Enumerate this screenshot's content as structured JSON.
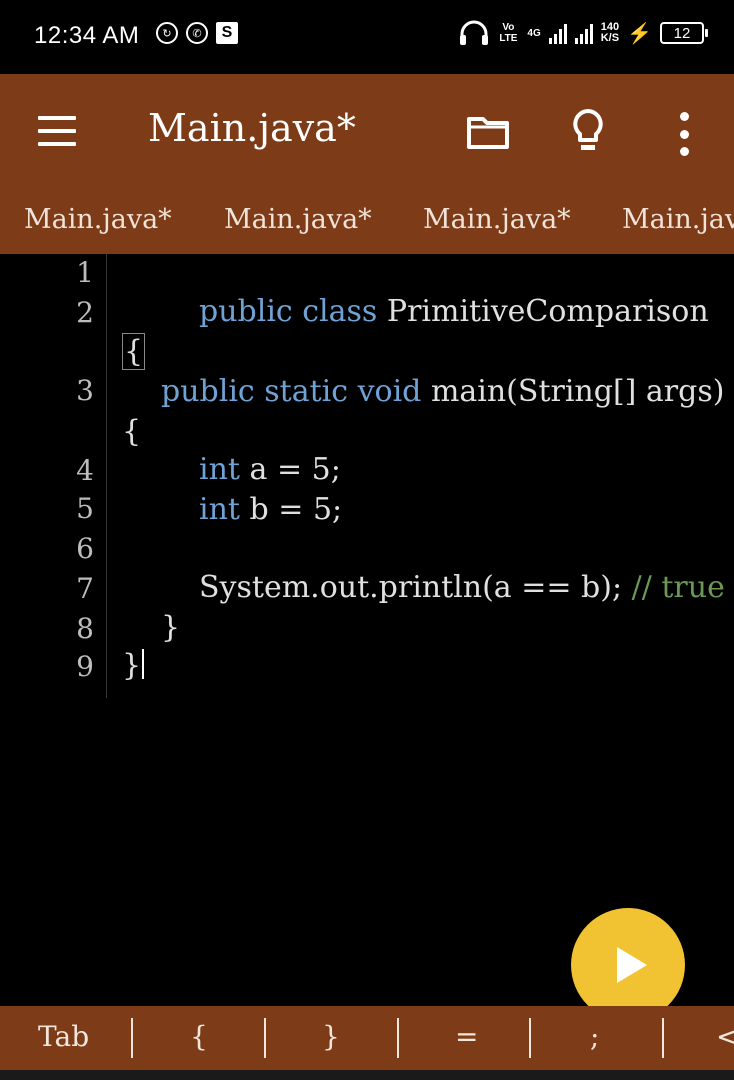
{
  "status_bar": {
    "time": "12:34 AM",
    "volte": "Vo LTE",
    "network": "4G",
    "speed_value": "140",
    "speed_unit": "K/S",
    "battery": "12"
  },
  "app_bar": {
    "title": "Main.java*"
  },
  "tabs": [
    "Main.java*",
    "Main.java*",
    "Main.java*",
    "Main.jav"
  ],
  "editor": {
    "line_numbers": [
      "1",
      "2",
      "3",
      "4",
      "5",
      "6",
      "7",
      "8",
      "9"
    ],
    "line2_kw": "public class",
    "line2_name": "PrimitiveComparison",
    "open_brace": "{",
    "line3_kw": "public static void",
    "line3_sig": "main(String[] args)",
    "line4_kw": "int",
    "line4_rest": "a = 5;",
    "line5_kw": "int",
    "line5_rest": "b = 5;",
    "line7_code": "System.out.println(a == b);",
    "line7_comment": "// true",
    "close_brace_inner": "}",
    "close_brace_outer": "}"
  },
  "symbol_bar": [
    "Tab",
    "{",
    "}",
    "=",
    ";",
    "<"
  ],
  "colors": {
    "accent": "#7d3b18",
    "keyword": "#6fa3d6",
    "comment": "#6a9955",
    "run_button": "#f1c232"
  }
}
